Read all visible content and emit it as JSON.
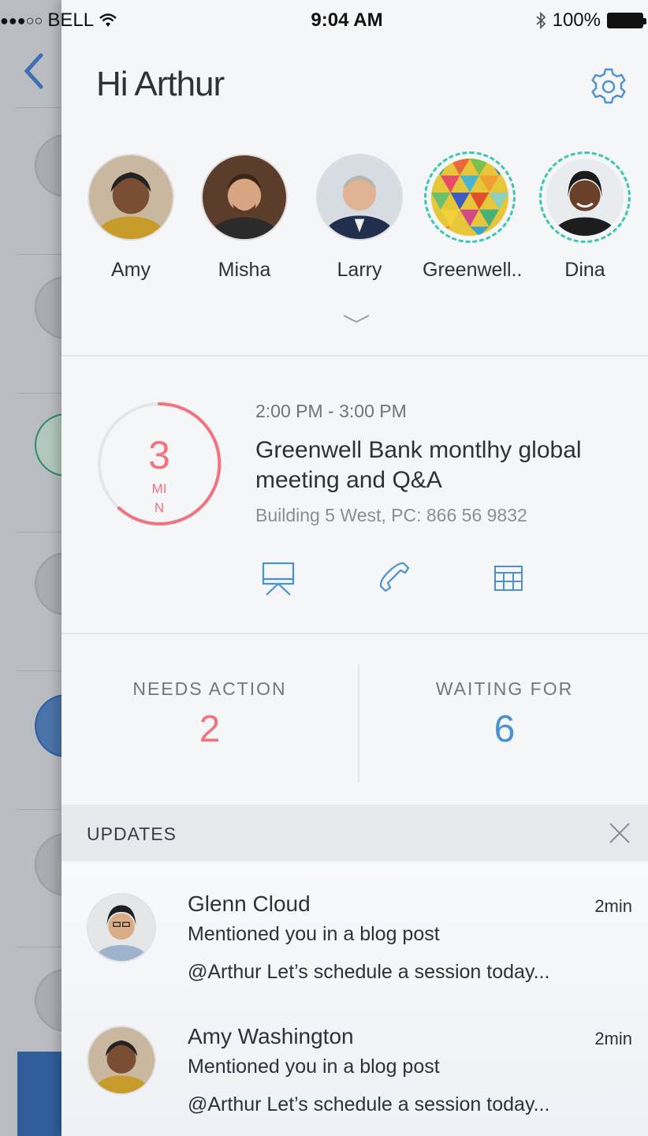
{
  "status_bar": {
    "carrier": "BELL",
    "time": "9:04 AM",
    "battery": "100%"
  },
  "header": {
    "greeting": "Hi Arthur"
  },
  "contacts": [
    {
      "name": "Amy",
      "ring": "none"
    },
    {
      "name": "Misha",
      "ring": "none"
    },
    {
      "name": "Larry",
      "ring": "none"
    },
    {
      "name": "Greenwell..",
      "ring": "dashed"
    },
    {
      "name": "Dina",
      "ring": "dashed"
    }
  ],
  "meeting": {
    "countdown_value": "3",
    "countdown_unit_line1": "MI",
    "countdown_unit_line2": "N",
    "time_range": "2:00 PM - 3:00 PM",
    "title": "Greenwell Bank montlhy global meeting and Q&A",
    "location": "Building 5 West, PC: 866  56  9832",
    "actions": [
      "presentation-icon",
      "phone-icon",
      "calendar-icon"
    ]
  },
  "counters": {
    "needs_action_label": "NEEDS ACTION",
    "needs_action_value": "2",
    "waiting_for_label": "WAITING FOR",
    "waiting_for_value": "6"
  },
  "updates": {
    "title": "UPDATES",
    "items": [
      {
        "name": "Glenn Cloud",
        "time": "2min",
        "action": "Mentioned you in a blog post",
        "message": "@Arthur Let’s schedule a session today..."
      },
      {
        "name": "Amy Washington",
        "time": "2min",
        "action": "Mentioned you in a blog post",
        "message": "@Arthur Let’s schedule a session today..."
      }
    ]
  },
  "colors": {
    "accent_blue": "#4a90d6",
    "alert_pink": "#ef7480",
    "teal_ring": "#3ec6b3"
  }
}
